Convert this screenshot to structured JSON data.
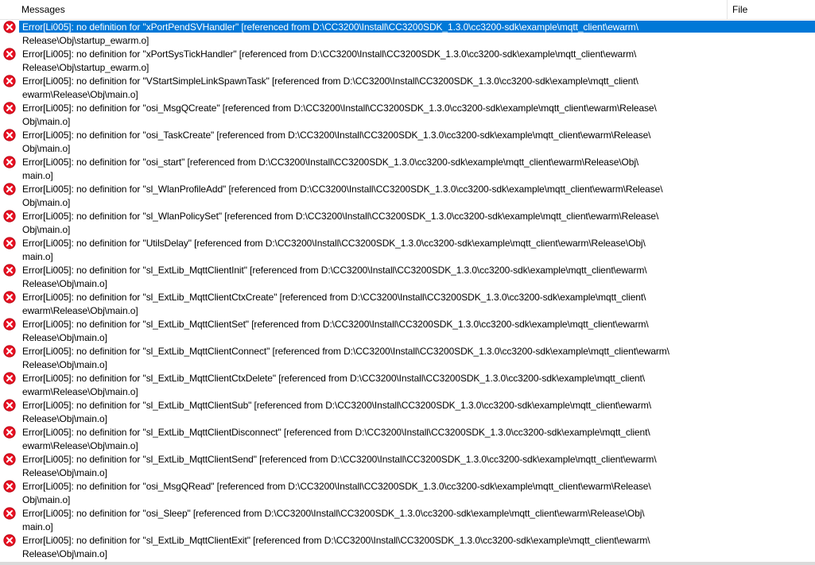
{
  "header": {
    "messages_label": "Messages",
    "file_label": "File"
  },
  "messages": [
    {
      "line1": "Error[Li005]: no definition for \"xPortPendSVHandler\" [referenced from D:\\CC3200\\Install\\CC3200SDK_1.3.0\\cc3200-sdk\\example\\mqtt_client\\ewarm\\",
      "line2": "Release\\Obj\\startup_ewarm.o]"
    },
    {
      "line1": "Error[Li005]: no definition for \"xPortSysTickHandler\" [referenced from D:\\CC3200\\Install\\CC3200SDK_1.3.0\\cc3200-sdk\\example\\mqtt_client\\ewarm\\",
      "line2": "Release\\Obj\\startup_ewarm.o]"
    },
    {
      "line1": "Error[Li005]: no definition for \"VStartSimpleLinkSpawnTask\" [referenced from D:\\CC3200\\Install\\CC3200SDK_1.3.0\\cc3200-sdk\\example\\mqtt_client\\",
      "line2": "ewarm\\Release\\Obj\\main.o]"
    },
    {
      "line1": "Error[Li005]: no definition for \"osi_MsgQCreate\" [referenced from D:\\CC3200\\Install\\CC3200SDK_1.3.0\\cc3200-sdk\\example\\mqtt_client\\ewarm\\Release\\",
      "line2": "Obj\\main.o]"
    },
    {
      "line1": "Error[Li005]: no definition for \"osi_TaskCreate\" [referenced from D:\\CC3200\\Install\\CC3200SDK_1.3.0\\cc3200-sdk\\example\\mqtt_client\\ewarm\\Release\\",
      "line2": "Obj\\main.o]"
    },
    {
      "line1": "Error[Li005]: no definition for \"osi_start\" [referenced from D:\\CC3200\\Install\\CC3200SDK_1.3.0\\cc3200-sdk\\example\\mqtt_client\\ewarm\\Release\\Obj\\",
      "line2": "main.o]"
    },
    {
      "line1": "Error[Li005]: no definition for \"sl_WlanProfileAdd\" [referenced from D:\\CC3200\\Install\\CC3200SDK_1.3.0\\cc3200-sdk\\example\\mqtt_client\\ewarm\\Release\\",
      "line2": "Obj\\main.o]"
    },
    {
      "line1": "Error[Li005]: no definition for \"sl_WlanPolicySet\" [referenced from D:\\CC3200\\Install\\CC3200SDK_1.3.0\\cc3200-sdk\\example\\mqtt_client\\ewarm\\Release\\",
      "line2": "Obj\\main.o]"
    },
    {
      "line1": "Error[Li005]: no definition for \"UtilsDelay\" [referenced from D:\\CC3200\\Install\\CC3200SDK_1.3.0\\cc3200-sdk\\example\\mqtt_client\\ewarm\\Release\\Obj\\",
      "line2": "main.o]"
    },
    {
      "line1": "Error[Li005]: no definition for \"sl_ExtLib_MqttClientInit\" [referenced from D:\\CC3200\\Install\\CC3200SDK_1.3.0\\cc3200-sdk\\example\\mqtt_client\\ewarm\\",
      "line2": "Release\\Obj\\main.o]"
    },
    {
      "line1": "Error[Li005]: no definition for \"sl_ExtLib_MqttClientCtxCreate\" [referenced from D:\\CC3200\\Install\\CC3200SDK_1.3.0\\cc3200-sdk\\example\\mqtt_client\\",
      "line2": "ewarm\\Release\\Obj\\main.o]"
    },
    {
      "line1": "Error[Li005]: no definition for \"sl_ExtLib_MqttClientSet\" [referenced from D:\\CC3200\\Install\\CC3200SDK_1.3.0\\cc3200-sdk\\example\\mqtt_client\\ewarm\\",
      "line2": "Release\\Obj\\main.o]"
    },
    {
      "line1": "Error[Li005]: no definition for \"sl_ExtLib_MqttClientConnect\" [referenced from D:\\CC3200\\Install\\CC3200SDK_1.3.0\\cc3200-sdk\\example\\mqtt_client\\ewarm\\",
      "line2": "Release\\Obj\\main.o]"
    },
    {
      "line1": "Error[Li005]: no definition for \"sl_ExtLib_MqttClientCtxDelete\" [referenced from D:\\CC3200\\Install\\CC3200SDK_1.3.0\\cc3200-sdk\\example\\mqtt_client\\",
      "line2": "ewarm\\Release\\Obj\\main.o]"
    },
    {
      "line1": "Error[Li005]: no definition for \"sl_ExtLib_MqttClientSub\" [referenced from D:\\CC3200\\Install\\CC3200SDK_1.3.0\\cc3200-sdk\\example\\mqtt_client\\ewarm\\",
      "line2": "Release\\Obj\\main.o]"
    },
    {
      "line1": "Error[Li005]: no definition for \"sl_ExtLib_MqttClientDisconnect\" [referenced from D:\\CC3200\\Install\\CC3200SDK_1.3.0\\cc3200-sdk\\example\\mqtt_client\\",
      "line2": "ewarm\\Release\\Obj\\main.o]"
    },
    {
      "line1": "Error[Li005]: no definition for \"sl_ExtLib_MqttClientSend\" [referenced from D:\\CC3200\\Install\\CC3200SDK_1.3.0\\cc3200-sdk\\example\\mqtt_client\\ewarm\\",
      "line2": "Release\\Obj\\main.o]"
    },
    {
      "line1": "Error[Li005]: no definition for \"osi_MsgQRead\" [referenced from D:\\CC3200\\Install\\CC3200SDK_1.3.0\\cc3200-sdk\\example\\mqtt_client\\ewarm\\Release\\",
      "line2": "Obj\\main.o]"
    },
    {
      "line1": "Error[Li005]: no definition for \"osi_Sleep\" [referenced from D:\\CC3200\\Install\\CC3200SDK_1.3.0\\cc3200-sdk\\example\\mqtt_client\\ewarm\\Release\\Obj\\",
      "line2": "main.o]"
    },
    {
      "line1": "Error[Li005]: no definition for \"sl_ExtLib_MqttClientExit\" [referenced from D:\\CC3200\\Install\\CC3200SDK_1.3.0\\cc3200-sdk\\example\\mqtt_client\\ewarm\\",
      "line2": "Release\\Obj\\main.o]"
    }
  ],
  "selected_index": 0,
  "icon": "error-icon",
  "colors": {
    "selection": "#0078d7",
    "error_red": "#e81123",
    "header_border": "#e5e5e5"
  }
}
